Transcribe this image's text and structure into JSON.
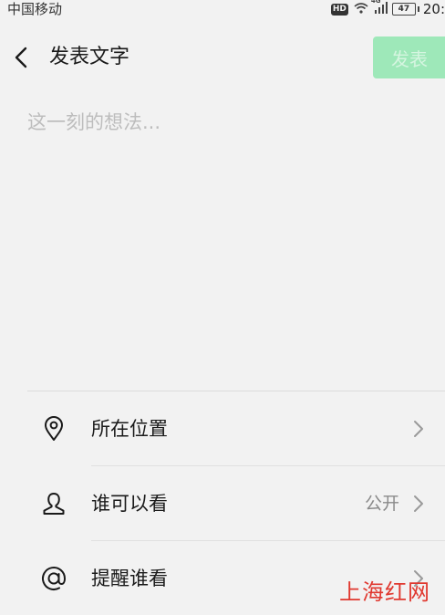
{
  "status_bar": {
    "carrier": "中国移动",
    "hd_badge": "HD",
    "network": "4G",
    "battery": "47",
    "time": "20:"
  },
  "header": {
    "title": "发表文字",
    "publish_label": "发表"
  },
  "composer": {
    "placeholder": "这一刻的想法..."
  },
  "options": [
    {
      "label": "所在位置",
      "value": "",
      "icon": "location-pin-icon"
    },
    {
      "label": "谁可以看",
      "value": "公开",
      "icon": "person-icon"
    },
    {
      "label": "提醒谁看",
      "value": "",
      "icon": "at-sign-icon"
    }
  ],
  "watermark": "上海红网",
  "colors": {
    "background": "#f2f2f2",
    "publish_button_disabled": "#9ee8b9",
    "placeholder_text": "#bdbdbd",
    "watermark": "#e0382f"
  }
}
